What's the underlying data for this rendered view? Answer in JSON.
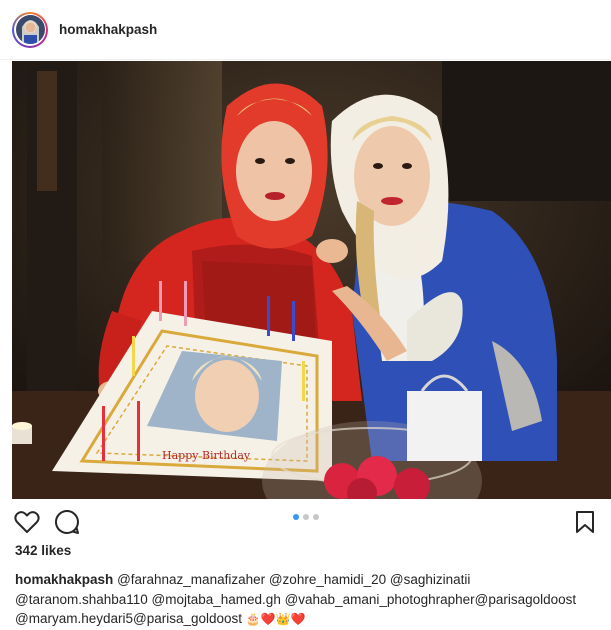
{
  "header": {
    "username": "homakhakpash"
  },
  "photo": {
    "alt_icon": "photo-image",
    "cake_text": "Happy Birthday"
  },
  "actions": {
    "like_icon": "heart-outline-icon",
    "comment_icon": "comment-bubble-icon",
    "save_icon": "bookmark-icon",
    "carousel_active_index": 1,
    "carousel_count": 3
  },
  "likes": {
    "text": "342 likes"
  },
  "caption": {
    "username": "homakhakpash",
    "line1": "@farahnaz_manafizaher @zohre_hamidi_20 @saghizinatii",
    "line2": "@taranom.shahba110 @mojtaba_hamed.gh @vahab_amani_photoghrapher@parisagoldoost",
    "line3": "@maryam.heydari5@parisa_goldoost",
    "emojis": "🎂❤️👑❤️"
  },
  "colors": {
    "accent_blue": "#3897f0",
    "text": "#262626",
    "border": "#efefef"
  }
}
